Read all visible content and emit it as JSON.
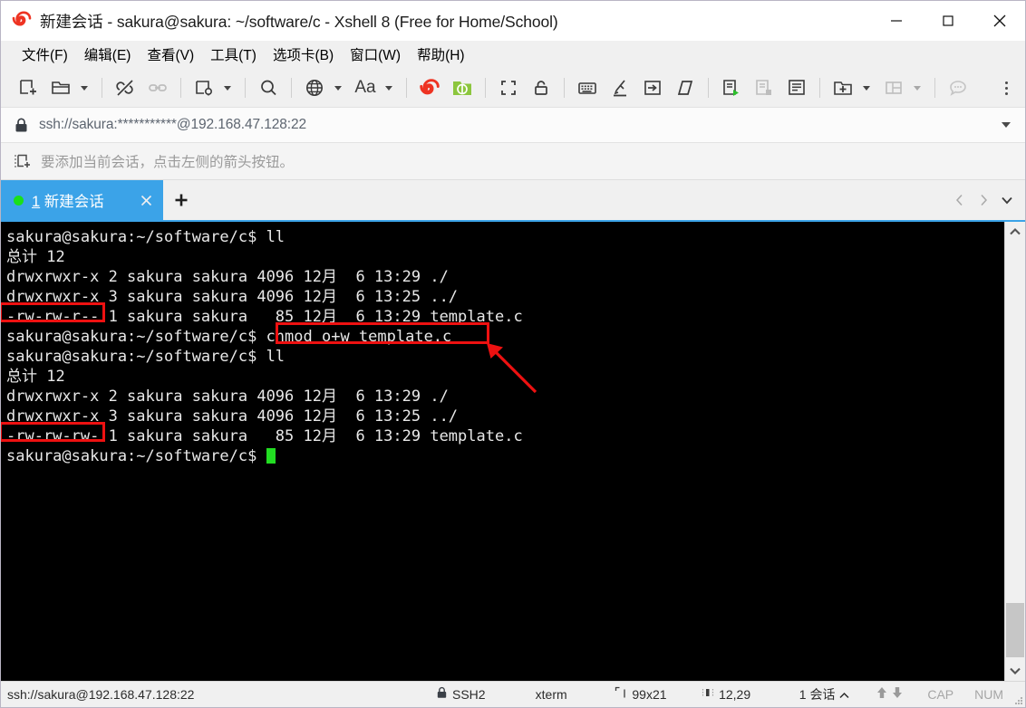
{
  "window": {
    "title": "新建会话 - sakura@sakura: ~/software/c - Xshell 8 (Free for Home/School)",
    "logo_icon": "xshell-spiral-logo-icon",
    "minimize_label": "—",
    "maximize_label": "□",
    "close_label": "✕"
  },
  "menubar": {
    "items": [
      {
        "label": "文件(F)",
        "name": "menu-file"
      },
      {
        "label": "编辑(E)",
        "name": "menu-edit"
      },
      {
        "label": "查看(V)",
        "name": "menu-view"
      },
      {
        "label": "工具(T)",
        "name": "menu-tools"
      },
      {
        "label": "选项卡(B)",
        "name": "menu-tab"
      },
      {
        "label": "窗口(W)",
        "name": "menu-window"
      },
      {
        "label": "帮助(H)",
        "name": "menu-help"
      }
    ]
  },
  "toolbar": {
    "icons": [
      "new-session-icon",
      "open-folder-icon",
      "disconnect-icon",
      "link-icon",
      "session-properties-icon",
      "find-icon",
      "globe-encoding-icon",
      "font-size-icon",
      "xshell-icon",
      "xftp-icon",
      "fullscreen-icon",
      "lock-icon",
      "keyboard-icon",
      "highlight-icon",
      "send-key-icon",
      "clear-screen-icon",
      "start-log-icon",
      "pause-log-icon",
      "view-log-icon",
      "new-tab-icon",
      "split-layout-icon",
      "chat-icon"
    ],
    "overflow_icon": "kebab-menu-icon"
  },
  "address": {
    "lock_icon": "lock-closed-icon",
    "value": "ssh://sakura:***********@192.168.47.128:22",
    "dropdown_icon": "chevron-down-icon"
  },
  "notice": {
    "icon": "add-session-icon",
    "text": "要添加当前会话，点击左侧的箭头按钮。"
  },
  "tabs": {
    "items": [
      {
        "name": "tab-session-1",
        "index_label": "1",
        "label": " 新建会话",
        "status_dot_color": "#1ae01a",
        "close_icon": "close-icon",
        "active": true
      }
    ],
    "new_tab_icon": "plus-icon",
    "nav_prev_icon": "chevron-left-icon",
    "nav_next_icon": "chevron-right-icon",
    "nav_list_icon": "chevron-down-icon"
  },
  "terminal": {
    "lines": [
      "sakura@sakura:~/software/c$ ll",
      "总计 12",
      "drwxrwxr-x 2 sakura sakura 4096 12月  6 13:29 ./",
      "drwxrwxr-x 3 sakura sakura 4096 12月  6 13:25 ../",
      "-rw-rw-r-- 1 sakura sakura   85 12月  6 13:29 template.c",
      "sakura@sakura:~/software/c$ chmod o+w template.c",
      "sakura@sakura:~/software/c$ ll",
      "总计 12",
      "drwxrwxr-x 2 sakura sakura 4096 12月  6 13:29 ./",
      "drwxrwxr-x 3 sakura sakura 4096 12月  6 13:25 ../",
      "-rw-rw-rw- 1 sakura sakura   85 12月  6 13:29 template.c",
      "sakura@sakura:~/software/c$ "
    ],
    "cursor_color": "#22dd22",
    "annotation_color": "#ee1111",
    "annotations": [
      {
        "name": "highlight-perms-before",
        "text": "-rw-rw-r--"
      },
      {
        "name": "highlight-chmod-command",
        "text": "chmod o+w template.c"
      },
      {
        "name": "highlight-perms-after",
        "text": "-rw-rw-rw-"
      },
      {
        "name": "pointer-arrow-to-chmod",
        "text": ""
      }
    ],
    "scrollbar": {
      "up_icon": "chevron-up-icon",
      "down_icon": "chevron-down-icon",
      "thumb": "scroll-thumb"
    }
  },
  "statusbar": {
    "connection": "ssh://sakura@192.168.47.128:22",
    "security_icon": "lock-closed-icon",
    "security": "SSH2",
    "terminal_type": "xterm",
    "size_icon": "screen-size-icon",
    "size": "99x21",
    "cursor_icon": "cursor-position-icon",
    "cursor_pos": "12,29",
    "sessions": "1 会话",
    "sessions_caret_icon": "caret-up-icon",
    "tx_icon": "upload-arrow-icon",
    "rx_icon": "download-arrow-icon",
    "caps": "CAP",
    "num": "NUM",
    "grip_icon": "resize-grip-icon"
  }
}
